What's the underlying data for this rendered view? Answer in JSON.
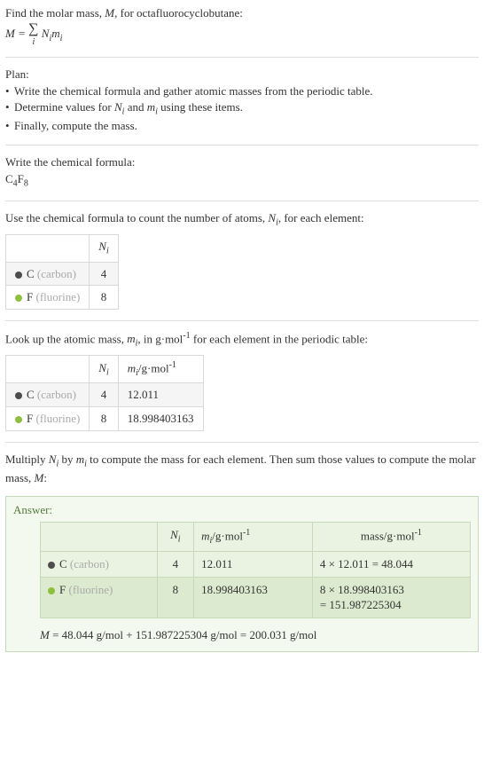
{
  "intro": {
    "line1": "Find the molar mass, ",
    "Mvar": "M",
    "line1b": ", for octafluorocyclobutane:",
    "eq_lhs": "M",
    "eq_eq": " = ",
    "eq_sigma": "∑",
    "eq_sub": "i",
    "eq_rhs1": "N",
    "eq_rhs1sub": "i",
    "eq_rhs2": "m",
    "eq_rhs2sub": "i"
  },
  "plan": {
    "title": "Plan:",
    "b1": "Write the chemical formula and gather atomic masses from the periodic table.",
    "b2a": "Determine values for ",
    "b2N": "N",
    "b2Ni": "i",
    "b2and": " and ",
    "b2m": "m",
    "b2mi": "i",
    "b2b": " using these items.",
    "b3": "Finally, compute the mass."
  },
  "chem": {
    "title": "Write the chemical formula:",
    "C": "C",
    "C4": "4",
    "F": "F",
    "F8": "8"
  },
  "count": {
    "title_a": "Use the chemical formula to count the number of atoms, ",
    "N": "N",
    "Ni": "i",
    "title_b": ", for each element:",
    "hdr_Ni_N": "N",
    "hdr_Ni_i": "i",
    "r1_name": "C",
    "r1_par": "(carbon)",
    "r1_val": "4",
    "r2_name": "F",
    "r2_par": "(fluorine)",
    "r2_val": "8"
  },
  "mass": {
    "title_a": "Look up the atomic mass, ",
    "m": "m",
    "mi": "i",
    "title_b": ", in g·mol",
    "exp": "-1",
    "title_c": " for each element in the periodic table:",
    "hdr_Ni_N": "N",
    "hdr_Ni_i": "i",
    "hdr_mi_m": "m",
    "hdr_mi_i": "i",
    "hdr_mi_unit": "/g·mol",
    "hdr_mi_exp": "-1",
    "r1_name": "C",
    "r1_par": "(carbon)",
    "r1_N": "4",
    "r1_m": "12.011",
    "r2_name": "F",
    "r2_par": "(fluorine)",
    "r2_N": "8",
    "r2_m": "18.998403163"
  },
  "mult": {
    "a": "Multiply ",
    "N": "N",
    "Ni": "i",
    "by": " by ",
    "m": "m",
    "mi": "i",
    "b": " to compute the mass for each element. Then sum those values to compute the molar mass, ",
    "M": "M",
    "c": ":"
  },
  "answer": {
    "label": "Answer:",
    "hdr_Ni_N": "N",
    "hdr_Ni_i": "i",
    "hdr_mi_m": "m",
    "hdr_mi_i": "i",
    "hdr_mi_unit": "/g·mol",
    "hdr_mi_exp": "-1",
    "hdr_mass": "mass/g·mol",
    "hdr_mass_exp": "-1",
    "r1_name": "C",
    "r1_par": "(carbon)",
    "r1_N": "4",
    "r1_m": "12.011",
    "r1_calc": "4 × 12.011 = 48.044",
    "r2_name": "F",
    "r2_par": "(fluorine)",
    "r2_N": "8",
    "r2_m": "18.998403163",
    "r2_calc_a": "8 × 18.998403163",
    "r2_calc_b": "= 151.987225304",
    "final_M": "M",
    "final_rest": " = 48.044 g/mol + 151.987225304 g/mol = 200.031 g/mol"
  }
}
